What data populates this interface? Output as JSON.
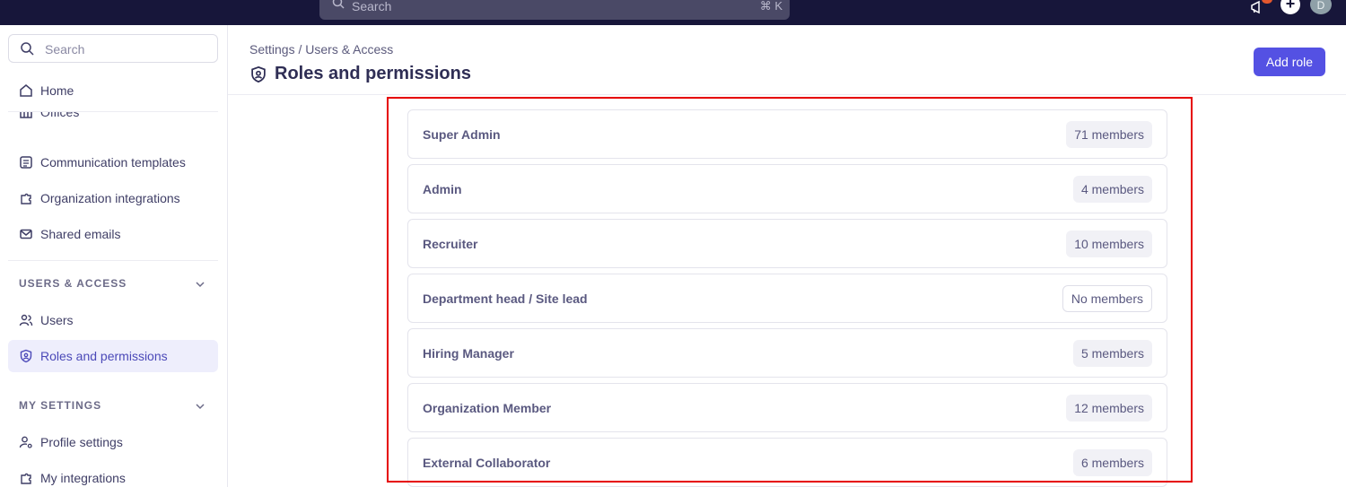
{
  "topbar": {
    "search_placeholder": "Search",
    "shortcut": "⌘ K",
    "avatar_initial": "D"
  },
  "sidebar": {
    "search_placeholder": "Search",
    "home": "Home",
    "clipped_item": "Offices",
    "items": [
      {
        "label": "Communication templates",
        "icon": "template-icon"
      },
      {
        "label": "Organization integrations",
        "icon": "puzzle-icon"
      },
      {
        "label": "Shared emails",
        "icon": "mail-icon"
      }
    ],
    "sections": [
      {
        "title": "USERS & ACCESS",
        "items": [
          {
            "label": "Users",
            "icon": "users-icon"
          },
          {
            "label": "Roles and permissions",
            "icon": "shield-icon",
            "active": true
          }
        ]
      },
      {
        "title": "MY SETTINGS",
        "items": [
          {
            "label": "Profile settings",
            "icon": "user-gear-icon"
          },
          {
            "label": "My integrations",
            "icon": "puzzle-icon"
          }
        ]
      }
    ]
  },
  "header": {
    "breadcrumb": "Settings / Users & Access",
    "title": "Roles and permissions",
    "add_role_label": "Add role"
  },
  "roles": [
    {
      "name": "Super Admin",
      "members": "71 members"
    },
    {
      "name": "Admin",
      "members": "4 members"
    },
    {
      "name": "Recruiter",
      "members": "10 members"
    },
    {
      "name": "Department head / Site lead",
      "members": "No members"
    },
    {
      "name": "Hiring Manager",
      "members": "5 members"
    },
    {
      "name": "Organization Member",
      "members": "12 members"
    },
    {
      "name": "External Collaborator",
      "members": "6 members"
    }
  ]
}
